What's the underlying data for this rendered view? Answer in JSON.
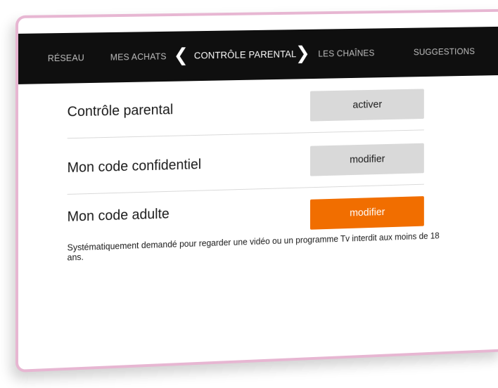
{
  "nav": {
    "items": [
      "RÉSEAU",
      "MES ACHATS",
      "CONTRÔLE PARENTAL",
      "LES CHAÎNES",
      "SUGGESTIONS"
    ],
    "active_index": 2,
    "prev_glyph": "❮",
    "next_glyph": "❯"
  },
  "rows": [
    {
      "label": "Contrôle parental",
      "button": "activer",
      "button_style": "grey"
    },
    {
      "label": "Mon code confidentiel",
      "button": "modifier",
      "button_style": "grey"
    },
    {
      "label": "Mon code adulte",
      "button": "modifier",
      "button_style": "orange"
    }
  ],
  "note": "Systématiquement demandé pour regarder une vidéo ou un programme Tv interdit aux moins de 18 ans.",
  "colors": {
    "nav_bg": "#0f0f0f",
    "accent": "#f16e00",
    "button_grey": "#d9d9d9",
    "frame": "#e7b6d2"
  }
}
